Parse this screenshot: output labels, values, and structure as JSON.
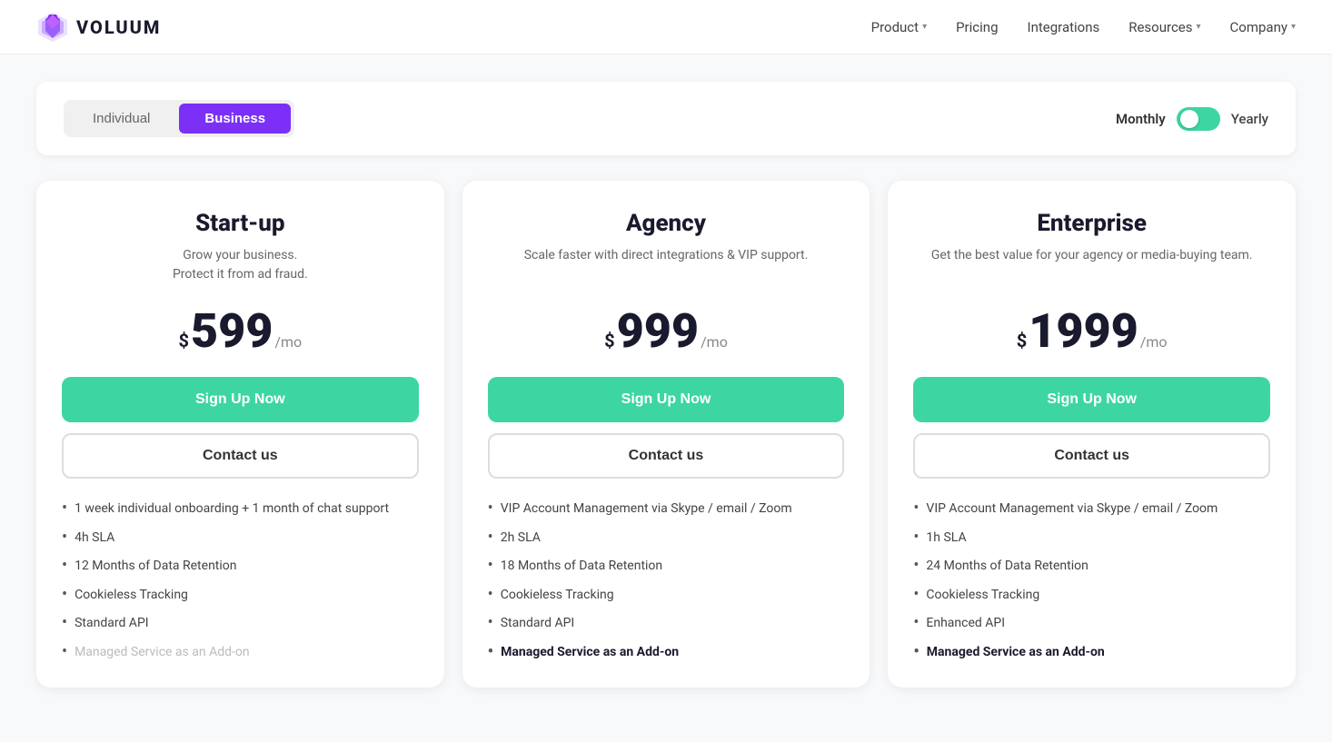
{
  "header": {
    "logo_text": "VOLUUM",
    "nav": [
      {
        "label": "Product",
        "has_dropdown": true
      },
      {
        "label": "Pricing",
        "has_dropdown": false
      },
      {
        "label": "Integrations",
        "has_dropdown": false
      },
      {
        "label": "Resources",
        "has_dropdown": true
      },
      {
        "label": "Company",
        "has_dropdown": true
      }
    ]
  },
  "plan_tabs": {
    "individual_label": "Individual",
    "business_label": "Business",
    "active": "Business"
  },
  "billing": {
    "monthly_label": "Monthly",
    "yearly_label": "Yearly",
    "active": "Monthly"
  },
  "plans": [
    {
      "id": "startup",
      "name": "Start-up",
      "description": "Grow your business.\nProtect it from ad fraud.",
      "price_dollar": "$",
      "price_amount": "599",
      "price_period": "/mo",
      "signup_label": "Sign Up Now",
      "contact_label": "Contact us",
      "features": [
        {
          "text": "1 week individual onboarding + 1 month of chat support",
          "bold": false,
          "muted": false
        },
        {
          "text": "4h SLA",
          "bold": false,
          "muted": false
        },
        {
          "text": "12 Months of Data Retention",
          "bold": false,
          "muted": false
        },
        {
          "text": "Cookieless Tracking",
          "bold": false,
          "muted": false
        },
        {
          "text": "Standard API",
          "bold": false,
          "muted": false
        },
        {
          "text": "Managed Service as an Add-on",
          "bold": false,
          "muted": true
        }
      ]
    },
    {
      "id": "agency",
      "name": "Agency",
      "description": "Scale faster with direct integrations & VIP support.",
      "price_dollar": "$",
      "price_amount": "999",
      "price_period": "/mo",
      "signup_label": "Sign Up Now",
      "contact_label": "Contact us",
      "features": [
        {
          "text": "VIP Account Management via Skype / email / Zoom",
          "bold": false,
          "muted": false
        },
        {
          "text": "2h SLA",
          "bold": false,
          "muted": false
        },
        {
          "text": "18 Months of Data Retention",
          "bold": false,
          "muted": false
        },
        {
          "text": "Cookieless Tracking",
          "bold": false,
          "muted": false
        },
        {
          "text": "Standard API",
          "bold": false,
          "muted": false
        },
        {
          "text": "Managed Service as an Add-on",
          "bold": true,
          "muted": false
        }
      ]
    },
    {
      "id": "enterprise",
      "name": "Enterprise",
      "description": "Get the best value for your agency or media-buying team.",
      "price_dollar": "$",
      "price_amount": "1999",
      "price_period": "/mo",
      "signup_label": "Sign Up Now",
      "contact_label": "Contact us",
      "features": [
        {
          "text": "VIP Account Management via Skype / email / Zoom",
          "bold": false,
          "muted": false
        },
        {
          "text": "1h SLA",
          "bold": false,
          "muted": false
        },
        {
          "text": "24 Months of Data Retention",
          "bold": false,
          "muted": false
        },
        {
          "text": "Cookieless Tracking",
          "bold": false,
          "muted": false
        },
        {
          "text": "Enhanced API",
          "bold": false,
          "muted": false
        },
        {
          "text": "Managed Service as an Add-on",
          "bold": true,
          "muted": false
        }
      ]
    }
  ]
}
